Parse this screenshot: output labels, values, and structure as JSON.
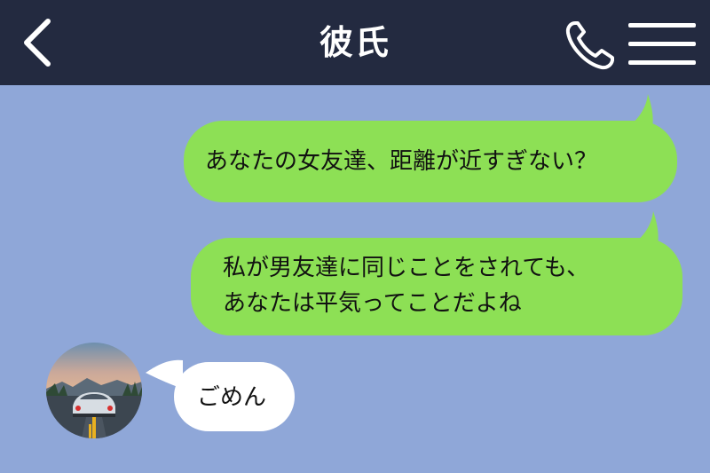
{
  "header": {
    "title": "彼氏",
    "back_icon": "chevron-left-icon",
    "call_icon": "phone-icon",
    "menu_icon": "hamburger-menu-icon"
  },
  "messages": [
    {
      "direction": "outgoing",
      "lines": [
        "あなたの女友達、距離が近すぎない？"
      ]
    },
    {
      "direction": "outgoing",
      "lines": [
        "私が男友達に同じことをされても、",
        "あなたは平気ってことだよね"
      ]
    },
    {
      "direction": "incoming",
      "lines": [
        "ごめん"
      ]
    }
  ],
  "colors": {
    "header_bg": "#232a40",
    "chat_bg": "#8fa7d8",
    "outgoing_bubble": "#8de055",
    "incoming_bubble": "#ffffff"
  }
}
